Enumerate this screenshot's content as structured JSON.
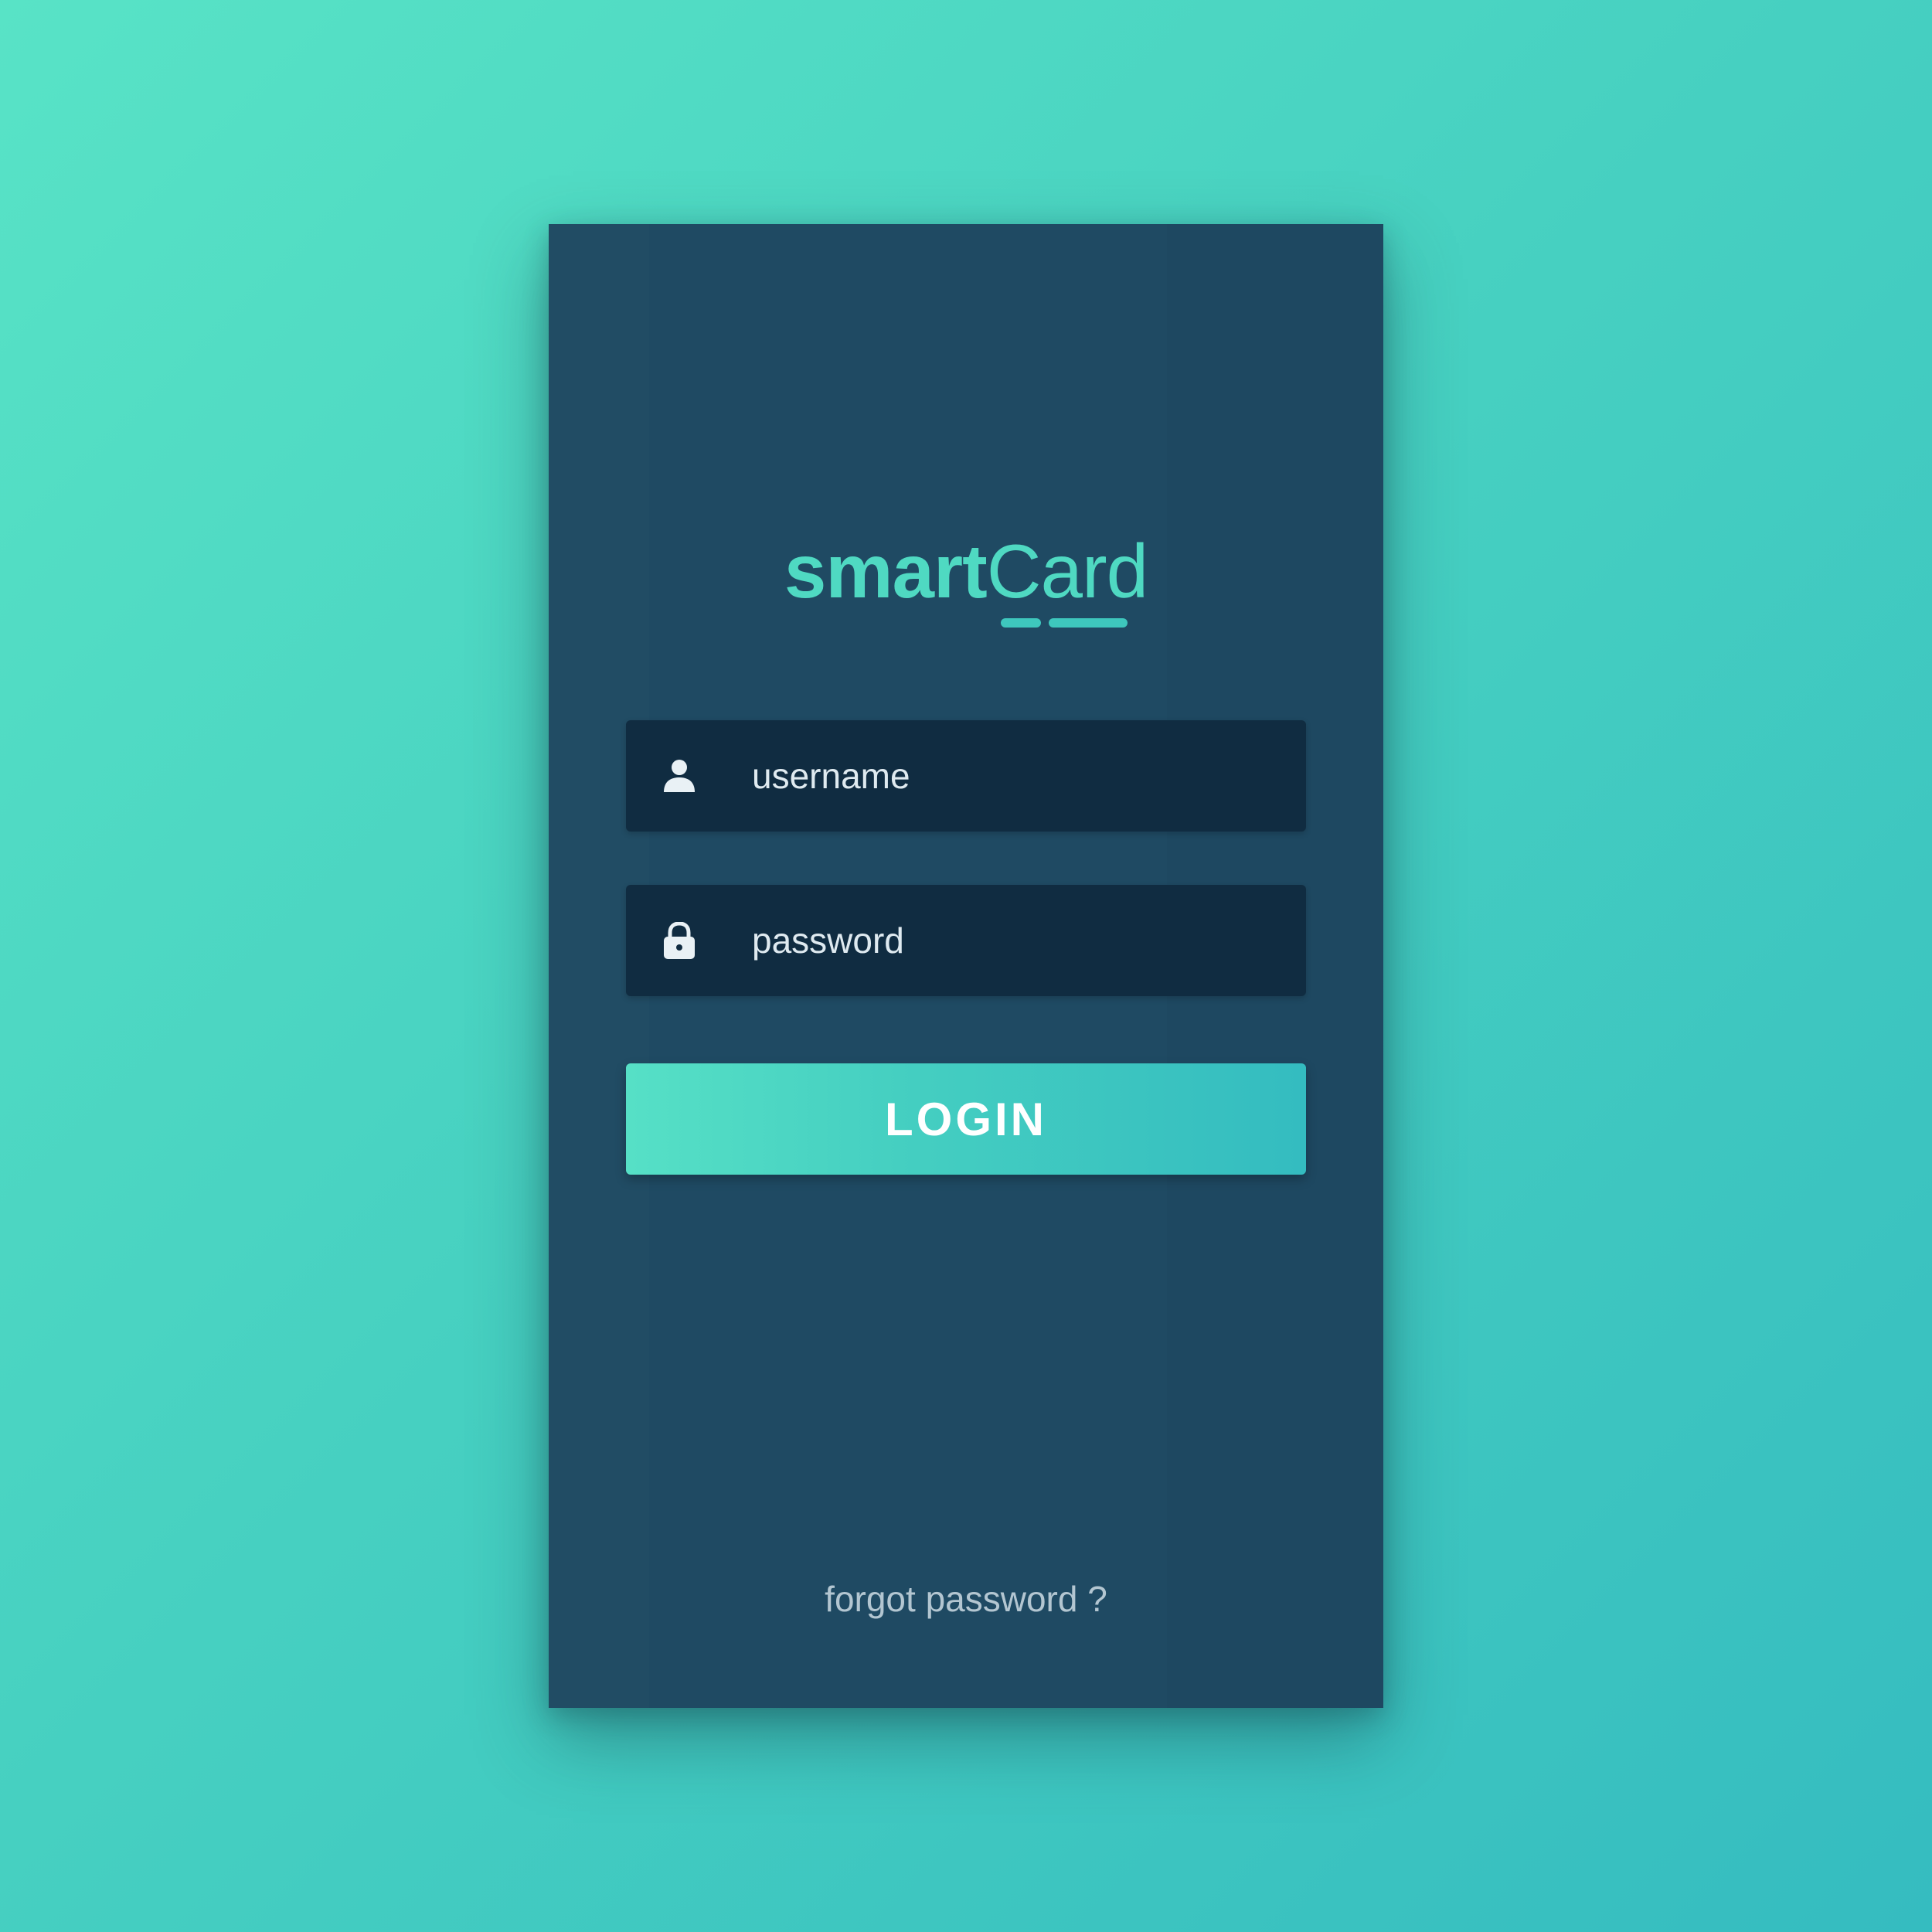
{
  "app": {
    "logo_bold": "smart",
    "logo_light": "Card"
  },
  "form": {
    "username_placeholder": "username",
    "username_value": "",
    "password_placeholder": "password",
    "password_value": "",
    "login_label": "LOGIN",
    "forgot_label": "forgot password ?"
  },
  "icons": {
    "username": "user-icon",
    "password": "lock-icon"
  },
  "colors": {
    "background_start": "#58e3c6",
    "background_end": "#35bcc0",
    "card": "#1f4a63",
    "field": "#102c41",
    "accent": "#4fd9c2",
    "button_start": "#56e0c6",
    "button_end": "#34bcc0"
  }
}
